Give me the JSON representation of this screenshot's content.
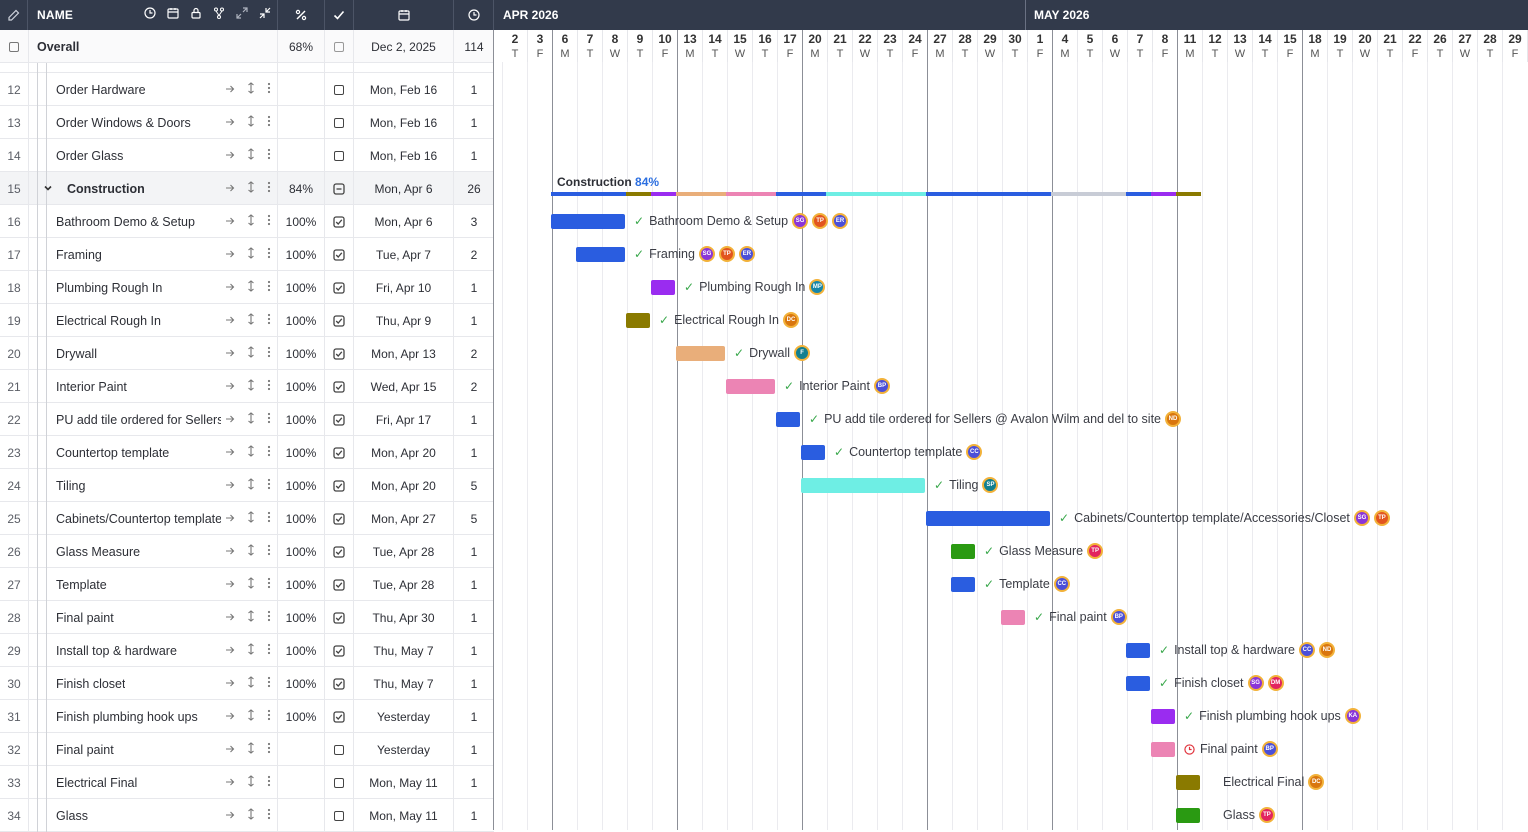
{
  "header": {
    "name_label": "NAME",
    "icons": [
      "edit-icon",
      "clock-icon",
      "calendar-icon",
      "lock-icon",
      "split-icon",
      "expand-icon",
      "collapse-icon",
      "percent-icon",
      "check-icon",
      "calendar-icon",
      "clock-icon"
    ],
    "months": [
      {
        "label": "APR 2026"
      },
      {
        "label": "MAY 2026"
      }
    ]
  },
  "days": [
    {
      "n": "2",
      "w": "T"
    },
    {
      "n": "3",
      "w": "F"
    },
    {
      "n": "6",
      "w": "M"
    },
    {
      "n": "7",
      "w": "T"
    },
    {
      "n": "8",
      "w": "W"
    },
    {
      "n": "9",
      "w": "T"
    },
    {
      "n": "10",
      "w": "F"
    },
    {
      "n": "13",
      "w": "M"
    },
    {
      "n": "14",
      "w": "T"
    },
    {
      "n": "15",
      "w": "W"
    },
    {
      "n": "16",
      "w": "T"
    },
    {
      "n": "17",
      "w": "F"
    },
    {
      "n": "20",
      "w": "M"
    },
    {
      "n": "21",
      "w": "T"
    },
    {
      "n": "22",
      "w": "W"
    },
    {
      "n": "23",
      "w": "T"
    },
    {
      "n": "24",
      "w": "F"
    },
    {
      "n": "27",
      "w": "M"
    },
    {
      "n": "28",
      "w": "T"
    },
    {
      "n": "29",
      "w": "W"
    },
    {
      "n": "30",
      "w": "T"
    },
    {
      "n": "1",
      "w": "F"
    },
    {
      "n": "4",
      "w": "M"
    },
    {
      "n": "5",
      "w": "T"
    },
    {
      "n": "6",
      "w": "W"
    },
    {
      "n": "7",
      "w": "T"
    },
    {
      "n": "8",
      "w": "F"
    },
    {
      "n": "11",
      "w": "M"
    },
    {
      "n": "12",
      "w": "T"
    },
    {
      "n": "13",
      "w": "W"
    },
    {
      "n": "14",
      "w": "T"
    },
    {
      "n": "15",
      "w": "F"
    },
    {
      "n": "18",
      "w": "M"
    },
    {
      "n": "19",
      "w": "T"
    },
    {
      "n": "20",
      "w": "W"
    },
    {
      "n": "21",
      "w": "T"
    },
    {
      "n": "22",
      "w": "F"
    },
    {
      "n": "26",
      "w": "T"
    },
    {
      "n": "27",
      "w": "W"
    },
    {
      "n": "28",
      "w": "T"
    },
    {
      "n": "29",
      "w": "F"
    }
  ],
  "overall": {
    "name": "Overall",
    "pct": "68%",
    "date": "Dec 2, 2025",
    "dur": "114"
  },
  "rows": [
    {
      "num": "12",
      "name": "Order Hardware",
      "pct": "",
      "checked": false,
      "date": "Mon, Feb 16",
      "dur": "1"
    },
    {
      "num": "13",
      "name": "Order Windows & Doors",
      "pct": "",
      "checked": false,
      "date": "Mon, Feb 16",
      "dur": "1"
    },
    {
      "num": "14",
      "name": "Order Glass",
      "pct": "",
      "checked": false,
      "date": "Mon, Feb 16",
      "dur": "1"
    },
    {
      "num": "15",
      "name": "Construction",
      "pct": "84%",
      "checked": false,
      "date": "Mon, Apr 6",
      "dur": "26",
      "parent": true
    },
    {
      "num": "16",
      "name": "Bathroom Demo & Setup",
      "pct": "100%",
      "checked": true,
      "date": "Mon, Apr 6",
      "dur": "3"
    },
    {
      "num": "17",
      "name": "Framing",
      "pct": "100%",
      "checked": true,
      "date": "Tue, Apr 7",
      "dur": "2"
    },
    {
      "num": "18",
      "name": "Plumbing Rough In",
      "pct": "100%",
      "checked": true,
      "date": "Fri, Apr 10",
      "dur": "1"
    },
    {
      "num": "19",
      "name": "Electrical Rough In",
      "pct": "100%",
      "checked": true,
      "date": "Thu, Apr 9",
      "dur": "1"
    },
    {
      "num": "20",
      "name": "Drywall",
      "pct": "100%",
      "checked": true,
      "date": "Mon, Apr 13",
      "dur": "2"
    },
    {
      "num": "21",
      "name": "Interior Paint",
      "pct": "100%",
      "checked": true,
      "date": "Wed, Apr 15",
      "dur": "2"
    },
    {
      "num": "22",
      "name": "PU add tile ordered for Sellers",
      "pct": "100%",
      "checked": true,
      "date": "Fri, Apr 17",
      "dur": "1"
    },
    {
      "num": "23",
      "name": "Countertop template",
      "pct": "100%",
      "checked": true,
      "date": "Mon, Apr 20",
      "dur": "1"
    },
    {
      "num": "24",
      "name": "Tiling",
      "pct": "100%",
      "checked": true,
      "date": "Mon, Apr 20",
      "dur": "5"
    },
    {
      "num": "25",
      "name": "Cabinets/Countertop template,",
      "pct": "100%",
      "checked": true,
      "date": "Mon, Apr 27",
      "dur": "5"
    },
    {
      "num": "26",
      "name": "Glass Measure",
      "pct": "100%",
      "checked": true,
      "date": "Tue, Apr 28",
      "dur": "1"
    },
    {
      "num": "27",
      "name": "Template",
      "pct": "100%",
      "checked": true,
      "date": "Tue, Apr 28",
      "dur": "1"
    },
    {
      "num": "28",
      "name": "Final paint",
      "pct": "100%",
      "checked": true,
      "date": "Thu, Apr 30",
      "dur": "1"
    },
    {
      "num": "29",
      "name": "Install top & hardware",
      "pct": "100%",
      "checked": true,
      "date": "Thu, May 7",
      "dur": "1"
    },
    {
      "num": "30",
      "name": "Finish closet",
      "pct": "100%",
      "checked": true,
      "date": "Thu, May 7",
      "dur": "1"
    },
    {
      "num": "31",
      "name": "Finish plumbing hook ups",
      "pct": "100%",
      "checked": true,
      "date": "Yesterday",
      "dur": "1"
    },
    {
      "num": "32",
      "name": "Final paint",
      "pct": "",
      "checked": false,
      "date": "Yesterday",
      "dur": "1"
    },
    {
      "num": "33",
      "name": "Electrical Final",
      "pct": "",
      "checked": false,
      "date": "Mon, May 11",
      "dur": "1"
    },
    {
      "num": "34",
      "name": "Glass",
      "pct": "",
      "checked": false,
      "date": "Mon, May 11",
      "dur": "1"
    }
  ],
  "construction_summary": {
    "name": "Construction",
    "pct": "84%"
  },
  "construction_segments": [
    {
      "start": 2,
      "len": 3,
      "color": "#2a5de0"
    },
    {
      "start": 5,
      "len": 1,
      "color": "#8a7a00"
    },
    {
      "start": 6,
      "len": 1,
      "color": "#9a2cf0"
    },
    {
      "start": 7,
      "len": 2,
      "color": "#e9ae7a"
    },
    {
      "start": 9,
      "len": 2,
      "color": "#ec84b4"
    },
    {
      "start": 11,
      "len": 2,
      "color": "#2a5de0"
    },
    {
      "start": 13,
      "len": 4,
      "color": "#6eeee4"
    },
    {
      "start": 17,
      "len": 5,
      "color": "#2a5de0"
    },
    {
      "start": 22,
      "len": 3,
      "color": "#c8ccd6"
    },
    {
      "start": 25,
      "len": 1,
      "color": "#2a5de0"
    },
    {
      "start": 26,
      "len": 1,
      "color": "#9a2cf0"
    },
    {
      "start": 27,
      "len": 1,
      "color": "#8a7a00"
    }
  ],
  "tasks": [
    {
      "row": 4,
      "start": 2,
      "len": 3,
      "color": "#2a5de0",
      "label": "Bathroom Demo & Setup",
      "done": true,
      "avatars": [
        {
          "t": "SG",
          "c": "#8a35d8"
        },
        {
          "t": "TP",
          "c": "#e2551f"
        },
        {
          "t": "ER",
          "c": "#4b4fd8"
        }
      ]
    },
    {
      "row": 5,
      "start": 3,
      "len": 2,
      "color": "#2a5de0",
      "label": "Framing",
      "done": true,
      "avatars": [
        {
          "t": "SG",
          "c": "#8a35d8"
        },
        {
          "t": "TP",
          "c": "#e2551f"
        },
        {
          "t": "ER",
          "c": "#4b4fd8"
        }
      ]
    },
    {
      "row": 6,
      "start": 6,
      "len": 1,
      "color": "#9a2cf0",
      "label": "Plumbing Rough In",
      "done": true,
      "avatars": [
        {
          "t": "MP",
          "c": "#1686a8"
        }
      ]
    },
    {
      "row": 7,
      "start": 5,
      "len": 1,
      "color": "#8a7a00",
      "label": "Electrical Rough In",
      "done": true,
      "avatars": [
        {
          "t": "DC",
          "c": "#d9760e"
        }
      ]
    },
    {
      "row": 8,
      "start": 7,
      "len": 2,
      "color": "#e9ae7a",
      "label": "Drywall",
      "done": true,
      "avatars": [
        {
          "t": "F",
          "c": "#127f8f"
        }
      ]
    },
    {
      "row": 9,
      "start": 9,
      "len": 2,
      "color": "#ec84b4",
      "label": "Interior Paint",
      "done": true,
      "avatars": [
        {
          "t": "BP",
          "c": "#4b4fd8"
        }
      ]
    },
    {
      "row": 10,
      "start": 11,
      "len": 1,
      "color": "#2a5de0",
      "label": "PU add tile ordered for Sellers @ Avalon Wilm and del to site",
      "done": true,
      "avatars": [
        {
          "t": "ND",
          "c": "#d9760e"
        }
      ]
    },
    {
      "row": 11,
      "start": 12,
      "len": 1,
      "color": "#2a5de0",
      "label": "Countertop template",
      "done": true,
      "avatars": [
        {
          "t": "CC",
          "c": "#4b4fd8"
        }
      ]
    },
    {
      "row": 12,
      "start": 12,
      "len": 5,
      "color": "#6eeee4",
      "label": "Tiling",
      "done": true,
      "avatars": [
        {
          "t": "SP",
          "c": "#127f8f"
        }
      ]
    },
    {
      "row": 13,
      "start": 17,
      "len": 5,
      "color": "#2a5de0",
      "label": "Cabinets/Countertop template/Accessories/Closet",
      "done": true,
      "avatars": [
        {
          "t": "SG",
          "c": "#8a35d8"
        },
        {
          "t": "TP",
          "c": "#e2551f"
        }
      ]
    },
    {
      "row": 14,
      "start": 18,
      "len": 1,
      "color": "#2a9a12",
      "label": "Glass Measure",
      "done": true,
      "avatars": [
        {
          "t": "TP",
          "c": "#e2245f"
        }
      ]
    },
    {
      "row": 15,
      "start": 18,
      "len": 1,
      "color": "#2a5de0",
      "label": "Template",
      "done": true,
      "avatars": [
        {
          "t": "CC",
          "c": "#4b4fd8"
        }
      ]
    },
    {
      "row": 16,
      "start": 20,
      "len": 1,
      "color": "#ec84b4",
      "label": "Final paint",
      "done": true,
      "avatars": [
        {
          "t": "BP",
          "c": "#4b4fd8"
        }
      ]
    },
    {
      "row": 17,
      "start": 25,
      "len": 1,
      "color": "#2a5de0",
      "label": "Install top & hardware",
      "done": true,
      "avatars": [
        {
          "t": "CC",
          "c": "#4b4fd8"
        },
        {
          "t": "ND",
          "c": "#d9760e"
        }
      ]
    },
    {
      "row": 18,
      "start": 25,
      "len": 1,
      "color": "#2a5de0",
      "label": "Finish closet",
      "done": true,
      "avatars": [
        {
          "t": "SG",
          "c": "#8a35d8"
        },
        {
          "t": "DM",
          "c": "#e2245f"
        }
      ]
    },
    {
      "row": 19,
      "start": 26,
      "len": 1,
      "color": "#9a2cf0",
      "label": "Finish plumbing hook ups",
      "done": true,
      "avatars": [
        {
          "t": "KA",
          "c": "#8a35d8"
        }
      ]
    },
    {
      "row": 20,
      "start": 26,
      "len": 1,
      "color": "#ec84b4",
      "label": "Final paint",
      "done": false,
      "late": true,
      "avatars": [
        {
          "t": "BP",
          "c": "#4b4fd8"
        }
      ]
    },
    {
      "row": 21,
      "start": 27,
      "len": 1,
      "color": "#8a7a00",
      "label": "Electrical Final",
      "done": false,
      "avatars": [
        {
          "t": "DC",
          "c": "#d9760e"
        }
      ]
    },
    {
      "row": 22,
      "start": 27,
      "len": 1,
      "color": "#2a9a12",
      "label": "Glass",
      "done": false,
      "avatars": [
        {
          "t": "TP",
          "c": "#e2245f"
        }
      ]
    }
  ]
}
